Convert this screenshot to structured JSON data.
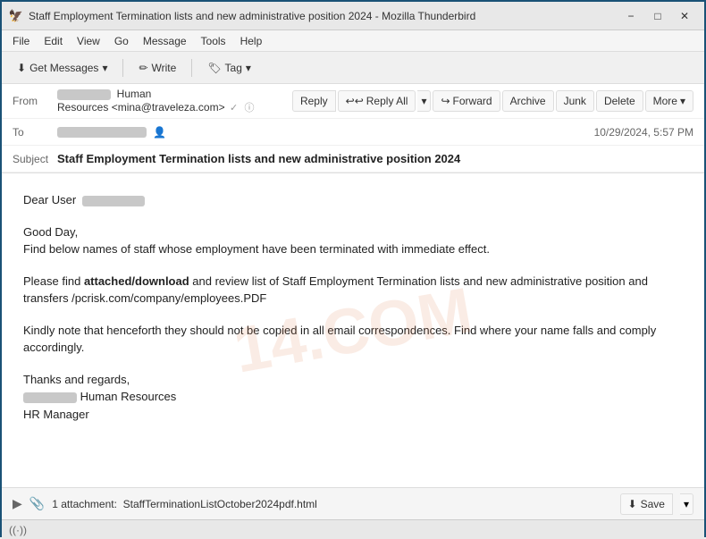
{
  "titlebar": {
    "title": "Staff Employment Termination lists and new administrative position 2024 - Mozilla Thunderbird",
    "icon": "🦅",
    "minimize_label": "−",
    "maximize_label": "□",
    "close_label": "✕"
  },
  "menubar": {
    "items": [
      "File",
      "Edit",
      "View",
      "Go",
      "Message",
      "Tools",
      "Help"
    ]
  },
  "toolbar": {
    "get_messages_label": "Get Messages",
    "write_label": "Write",
    "tag_label": "Tag"
  },
  "header": {
    "from_label": "From",
    "from_name": "Human Resources",
    "from_email": "<mina@traveleza.com>",
    "to_label": "To",
    "timestamp": "10/29/2024, 5:57 PM",
    "subject_label": "Subject",
    "subject_value": "Staff Employment Termination lists and new administrative position 2024",
    "reply_label": "Reply",
    "reply_all_label": "Reply All",
    "forward_label": "Forward",
    "archive_label": "Archive",
    "junk_label": "Junk",
    "delete_label": "Delete",
    "more_label": "More"
  },
  "body": {
    "greeting": "Dear User",
    "line1": "Good Day,",
    "line2": "Find below names of staff whose employment have been terminated with immediate effect.",
    "line3_prefix": "Please find ",
    "line3_bold": "attached/download",
    "line3_suffix": " and review list of Staff Employment Termination lists and new administrative position and  transfers /pcrisk.com/company/employees.PDF",
    "line4": "Kindly note that henceforth they should not be copied in all email correspondences. Find where your name falls and comply accordingly.",
    "sign1": "Thanks and regards,",
    "sign2": "Human Resources",
    "sign3": "HR Manager"
  },
  "attachment": {
    "count": "1 attachment:",
    "filename": "StaffTerminationListOctober2024pdf.html",
    "save_label": "Save"
  },
  "statusbar": {
    "icon": "((·))"
  },
  "watermark": "14.COM"
}
